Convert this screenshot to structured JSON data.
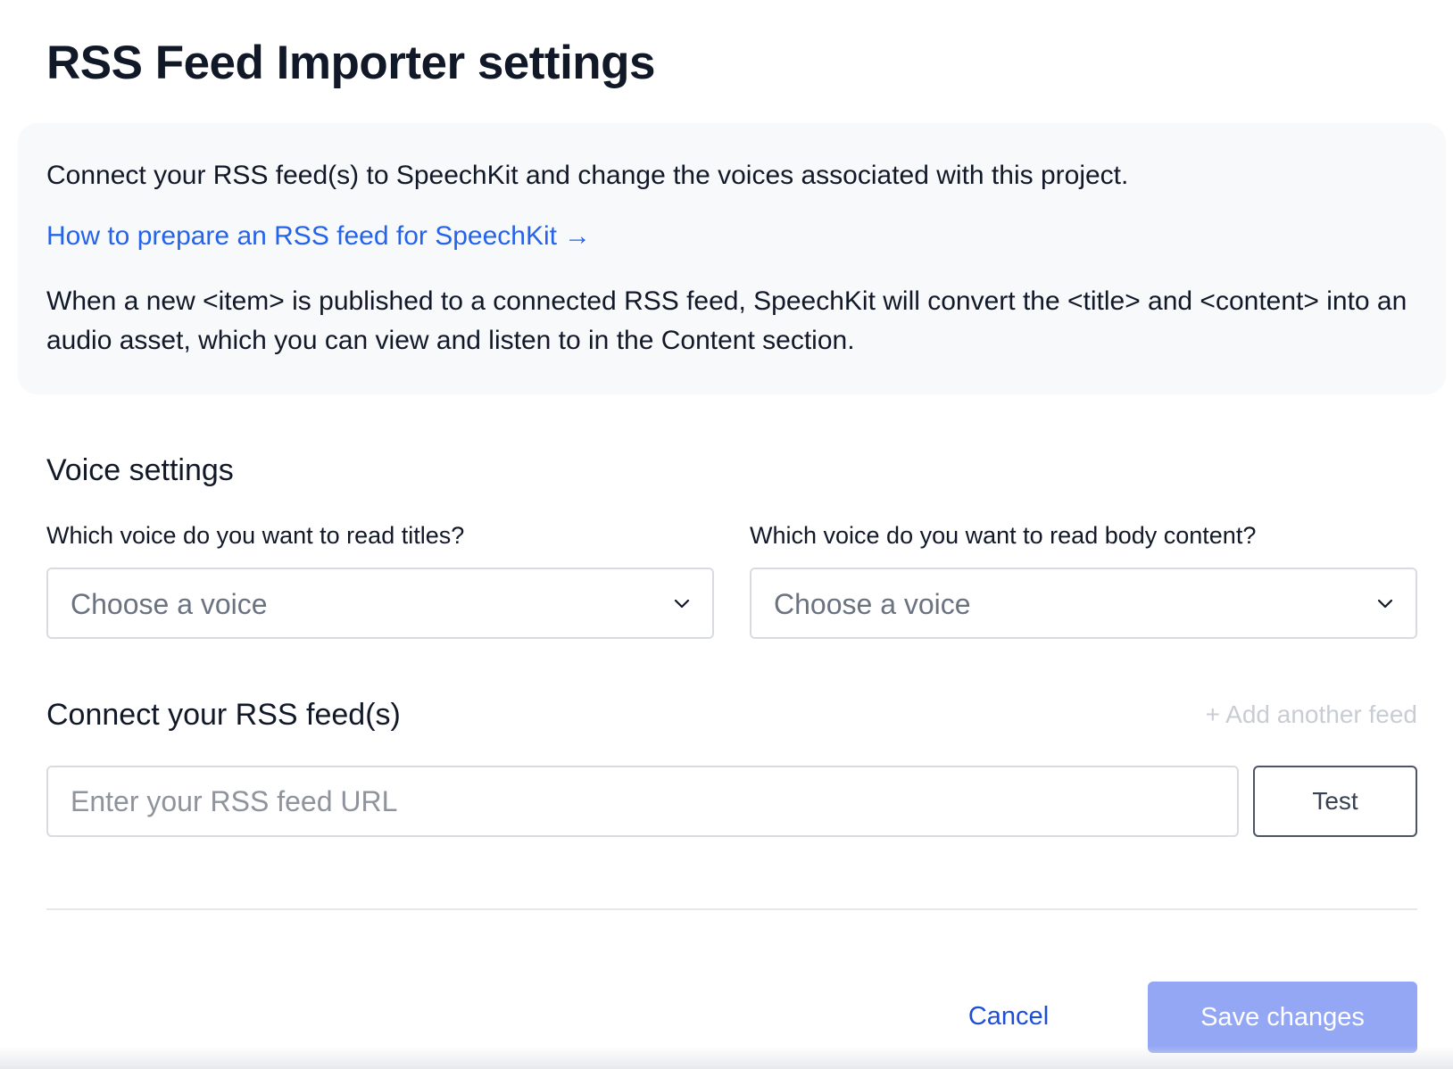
{
  "page": {
    "title": "RSS Feed Importer settings"
  },
  "info": {
    "intro": "Connect your RSS feed(s) to SpeechKit and change the voices associated with this project.",
    "link_label": "How to prepare an RSS feed for SpeechKit",
    "link_arrow": "→",
    "description": "When a new <item> is published to a connected RSS feed, SpeechKit will convert the <title> and <content> into an audio asset, which you can view and listen to in the Content section."
  },
  "voice_settings": {
    "heading": "Voice settings",
    "title_voice": {
      "label": "Which voice do you want to read titles?",
      "selected": "Choose a voice"
    },
    "body_voice": {
      "label": "Which voice do you want to read body content?",
      "selected": "Choose a voice"
    }
  },
  "feeds": {
    "heading": "Connect your RSS feed(s)",
    "add_label": "+ Add another feed",
    "url_placeholder": "Enter your RSS feed URL",
    "url_value": "",
    "test_label": "Test"
  },
  "footer": {
    "cancel_label": "Cancel",
    "save_label": "Save changes"
  },
  "colors": {
    "link": "#2563eb",
    "primary_disabled": "#93a7f4",
    "info_background": "#f8f9fb",
    "muted_text": "#c9cdd3"
  },
  "icons": {
    "select_chevron": "chevron-down-icon",
    "link_arrow": "arrow-right-icon"
  }
}
